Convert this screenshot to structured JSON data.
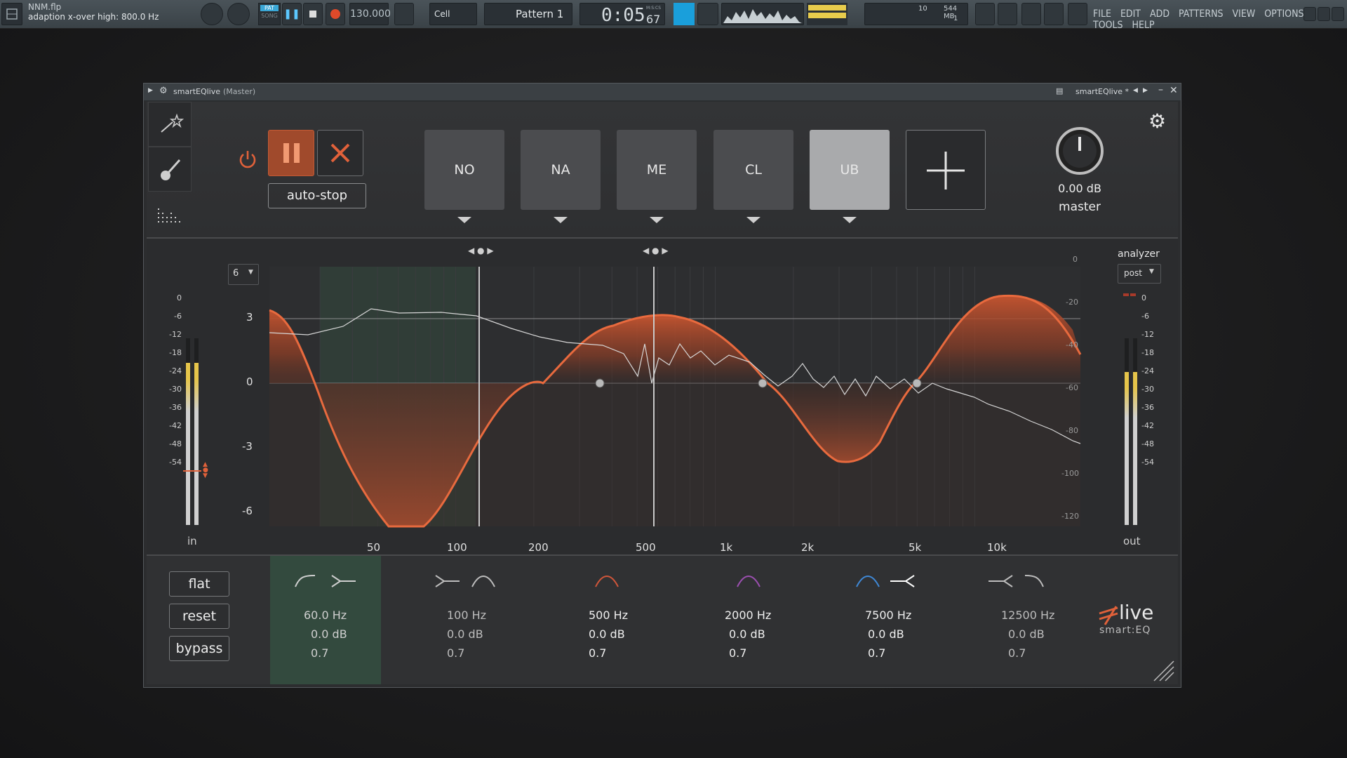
{
  "toolbar": {
    "project_name": "NNM.flp",
    "hint": "adaption x-over high: 800.0 Hz",
    "pat_label": "PAT",
    "song_label": "SONG",
    "tempo": "130.000",
    "snap": "Cell",
    "pattern": "Pattern 1",
    "time_main": "0:05",
    "time_sub": "67",
    "time_unit": "M:S:CS",
    "cpu": "10",
    "memory": "544 MB",
    "voices": "1",
    "menu": [
      "FILE",
      "EDIT",
      "ADD",
      "PATTERNS",
      "VIEW",
      "OPTIONS",
      "TOOLS",
      "HELP"
    ]
  },
  "window": {
    "title": "smartEQlive",
    "title_suffix": "(Master)",
    "preset_name": "smartEQlive *"
  },
  "header": {
    "auto_stop": "auto-stop",
    "profiles": [
      {
        "label": "NO",
        "selected": false
      },
      {
        "label": "NA",
        "selected": false
      },
      {
        "label": "ME",
        "selected": false
      },
      {
        "label": "CL",
        "selected": false
      },
      {
        "label": "UB",
        "selected": true
      }
    ],
    "master_gain": "0.00 dB",
    "master_label": "master"
  },
  "graph": {
    "range_select": "6",
    "analyzer_label": "analyzer",
    "analyzer_mode": "post",
    "in_label": "in",
    "out_label": "out",
    "meter_scale": [
      "0",
      "-6",
      "-12",
      "-18",
      "-24",
      "-30",
      "-36",
      "-42",
      "-48",
      "-54"
    ],
    "db_scale": [
      "3",
      "0",
      "-3",
      "-6"
    ],
    "analyzer_scale": [
      "0",
      "-20",
      "-40",
      "-60",
      "-80",
      "-100",
      "-120"
    ],
    "freq_labels": [
      "50",
      "100",
      "200",
      "500",
      "1k",
      "2k",
      "5k",
      "10k"
    ],
    "in_level": 0.87,
    "out_level": 0.82
  },
  "bottom": {
    "flat": "flat",
    "reset": "reset",
    "bypass": "bypass",
    "bands": [
      {
        "freq": "60.0",
        "unit": "Hz",
        "gain": "0.0",
        "gain_unit": "dB",
        "q": "0.7",
        "active": true
      },
      {
        "freq": "100",
        "unit": "Hz",
        "gain": "0.0",
        "gain_unit": "dB",
        "q": "0.7",
        "active": false
      },
      {
        "freq": "500",
        "unit": "Hz",
        "gain": "0.0",
        "gain_unit": "dB",
        "q": "0.7",
        "active": false
      },
      {
        "freq": "2000",
        "unit": "Hz",
        "gain": "0.0",
        "gain_unit": "dB",
        "q": "0.7",
        "active": false
      },
      {
        "freq": "7500",
        "unit": "Hz",
        "gain": "0.0",
        "gain_unit": "dB",
        "q": "0.7",
        "active": false
      },
      {
        "freq": "12500",
        "unit": "Hz",
        "gain": "0.0",
        "gain_unit": "dB",
        "q": "0.7",
        "active": false
      }
    ],
    "logo_live": "live",
    "logo_sub": "smart:EQ"
  },
  "colors": {
    "accent": "#e0613a",
    "curve_fill": "#c85530",
    "active_band": "#334a3e",
    "selected_profile": "#a9aaac",
    "band_red": "#d0563a",
    "band_purple": "#9b4fb0",
    "band_blue": "#3f88d6"
  }
}
